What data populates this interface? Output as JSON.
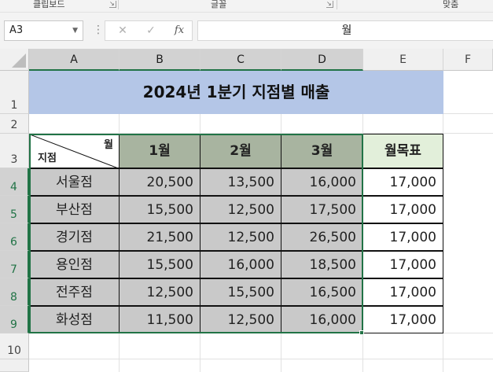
{
  "ribbon": {
    "groups": [
      {
        "label": "클립보드"
      },
      {
        "label": "글꼴"
      },
      {
        "label": "맞춤"
      }
    ]
  },
  "formula_bar": {
    "name_box": "A3",
    "cancel_icon": "✕",
    "enter_icon": "✓",
    "fx_label": "fx",
    "content": "월"
  },
  "columns": [
    "A",
    "B",
    "C",
    "D",
    "E",
    "F"
  ],
  "rows": [
    "1",
    "2",
    "3",
    "4",
    "5",
    "6",
    "7",
    "8",
    "9",
    "10"
  ],
  "sheet": {
    "title": "2024년 1분기 지점별 매출",
    "corner_top": "월",
    "corner_bottom": "지점",
    "months": [
      "1월",
      "2월",
      "3월"
    ],
    "target_header": "월목표",
    "branches": [
      {
        "name": "서울점",
        "m1": "20,500",
        "m2": "13,500",
        "m3": "16,000",
        "target": "17,000"
      },
      {
        "name": "부산점",
        "m1": "15,500",
        "m2": "12,500",
        "m3": "17,500",
        "target": "17,000"
      },
      {
        "name": "경기점",
        "m1": "21,500",
        "m2": "12,500",
        "m3": "26,500",
        "target": "17,000"
      },
      {
        "name": "용인점",
        "m1": "15,500",
        "m2": "16,000",
        "m3": "18,500",
        "target": "17,000"
      },
      {
        "name": "전주점",
        "m1": "12,500",
        "m2": "15,500",
        "m3": "16,500",
        "target": "17,000"
      },
      {
        "name": "화성점",
        "m1": "11,500",
        "m2": "12,500",
        "m3": "16,000",
        "target": "17,000"
      }
    ]
  },
  "colors": {
    "title_fill": "#b4c6e7",
    "header_fill": "#a8b4a0",
    "target_fill": "#e2efda",
    "data_fill": "#c9c9c9",
    "selection": "#217346"
  }
}
